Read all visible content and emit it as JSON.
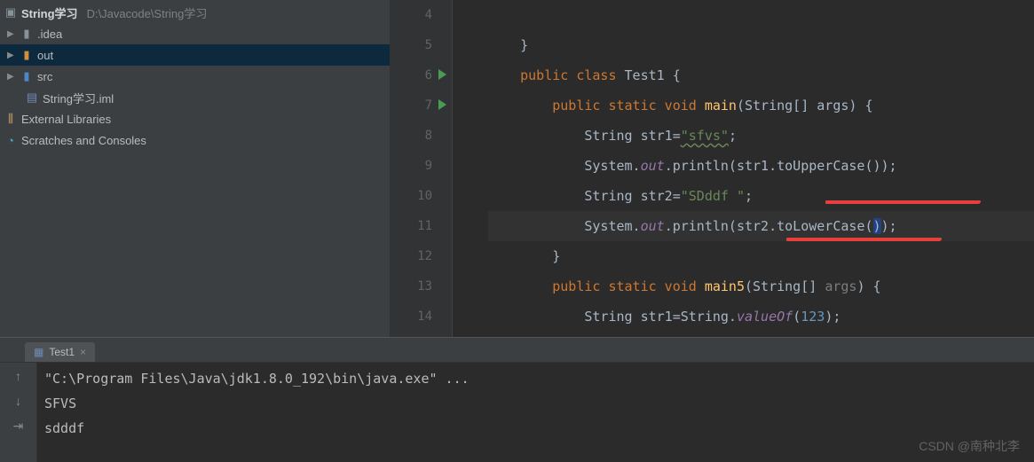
{
  "project": {
    "name": "String学习",
    "path": "D:\\Javacode\\String学习",
    "nodes": [
      {
        "label": ".idea",
        "icon": "folder",
        "expandable": true
      },
      {
        "label": "out",
        "icon": "folder-orange",
        "expandable": true,
        "selected": true
      },
      {
        "label": "src",
        "icon": "folder-blue",
        "expandable": true
      },
      {
        "label": "String学习.iml",
        "icon": "file",
        "expandable": false
      }
    ],
    "external": "External Libraries",
    "scratches": "Scratches and Consoles"
  },
  "editor": {
    "lines": [
      4,
      5,
      6,
      7,
      8,
      9,
      10,
      11,
      12,
      13,
      14
    ],
    "runnable": [
      6,
      7
    ],
    "highlighted": 11,
    "code": {
      "l5": "    }",
      "l6_pre": "    ",
      "l6_kw1": "public class ",
      "l6_name": "Test1 {",
      "l7_pre": "        ",
      "l7_kw": "public static void ",
      "l7_method": "main",
      "l7_sig1": "(String[] args) {",
      "l8_pre": "            String str1=",
      "l8_str": "\"sfvs\"",
      "l8_end": ";",
      "l9_pre": "            System.",
      "l9_field": "out",
      "l9_mid": ".println(str1.toUpperCase());",
      "l10_pre": "            String str2=",
      "l10_str": "\"SDddf \"",
      "l10_end": ";",
      "l11_pre": "            System.",
      "l11_field": "out",
      "l11_mid": ".println(str2.toLowerCase(",
      "l11_caret": ")",
      "l11_end": ");",
      "l12": "        }",
      "l13_pre": "        ",
      "l13_kw": "public static void ",
      "l13_method": "main5",
      "l13_sig_a": "(String[] ",
      "l13_sig_b": "args",
      "l13_sig_c": ") {",
      "l14_pre": "            String str1=String.",
      "l14_method": "valueOf",
      "l14_a": "(",
      "l14_num": "123",
      "l14_b": ");"
    }
  },
  "run": {
    "tab_label": "Test1",
    "cmd": "\"C:\\Program Files\\Java\\jdk1.8.0_192\\bin\\java.exe\" ...",
    "out1": "SFVS",
    "out2": "sdddf"
  },
  "watermark": "CSDN @南种北李"
}
